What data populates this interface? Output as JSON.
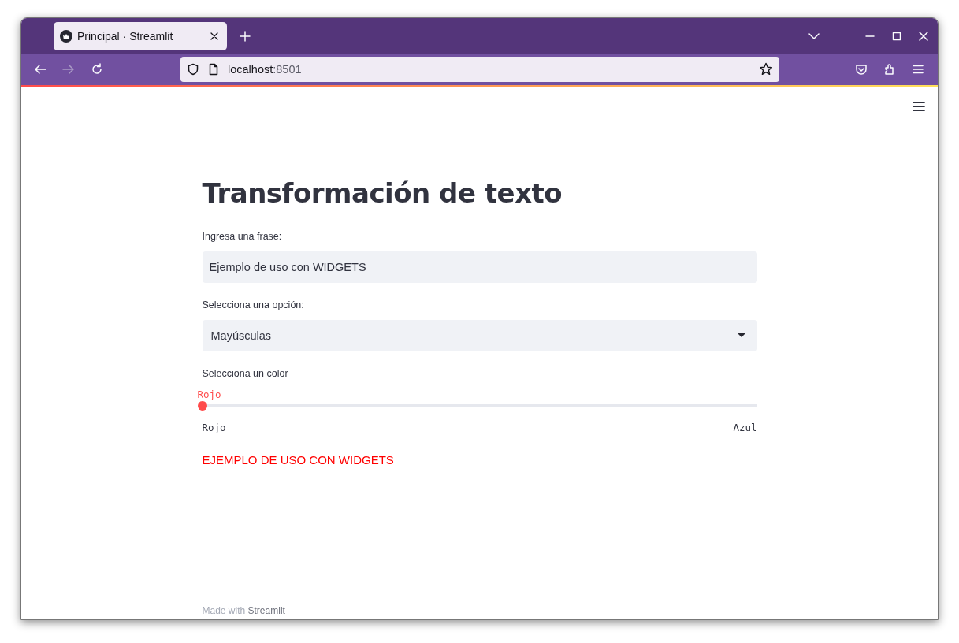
{
  "browser": {
    "tabs": [
      {
        "title": "Principal · Streamlit",
        "selected": true
      }
    ],
    "nav": [
      {
        "kind": "back",
        "disabled": false
      },
      {
        "kind": "forward",
        "disabled": true
      },
      {
        "kind": "reload",
        "disabled": false
      }
    ],
    "url": {
      "host": "localhost",
      "port": ":8501"
    }
  },
  "app": {
    "title": "Transformación de texto",
    "text_input": {
      "label": "Ingresa una frase:",
      "value": "Ejemplo de uso con WIDGETS"
    },
    "select": {
      "label": "Selecciona una opción:",
      "value": "Mayúsculas"
    },
    "slider": {
      "label": "Selecciona un color",
      "value_label": "Rojo",
      "level": 0,
      "min_label": "Rojo",
      "max_label": "Azul"
    },
    "output": "EJEMPLO DE USO CON WIDGETS",
    "footer": {
      "prefix": "Made with ",
      "brand": "Streamlit"
    }
  }
}
